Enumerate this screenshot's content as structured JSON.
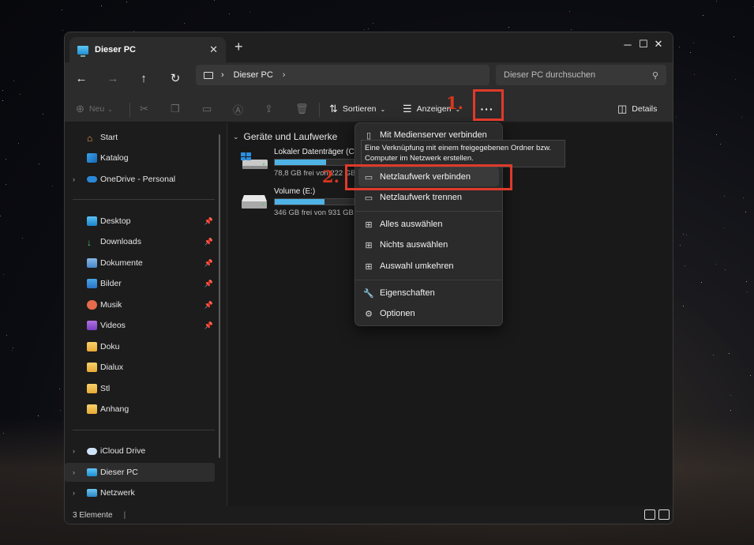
{
  "window": {
    "tab_title": "Dieser PC",
    "tab_close": "✕",
    "new_tab": "+",
    "minimize": "─",
    "maximize": "☐",
    "close": "✕"
  },
  "nav": {
    "back": "←",
    "forward": "→",
    "up": "↑",
    "refresh": "↻"
  },
  "address": {
    "sep1": "›",
    "path": "Dieser PC",
    "sep2": "›"
  },
  "search": {
    "placeholder": "Dieser PC durchsuchen",
    "icon": "⚲"
  },
  "toolbar": {
    "new_label": "Neu",
    "sort_label": "Sortieren",
    "view_label": "Anzeigen",
    "more_label": "···",
    "details_label": "Details"
  },
  "sidebar": {
    "items": [
      {
        "label": "Start",
        "icon": "home-icon"
      },
      {
        "label": "Katalog",
        "icon": "gallery-icon"
      },
      {
        "label": "OneDrive - Personal",
        "icon": "onedrive-icon"
      },
      {
        "label": "Desktop",
        "icon": "desktop-icon"
      },
      {
        "label": "Downloads",
        "icon": "downloads-icon"
      },
      {
        "label": "Dokumente",
        "icon": "documents-icon"
      },
      {
        "label": "Bilder",
        "icon": "pictures-icon"
      },
      {
        "label": "Musik",
        "icon": "music-icon"
      },
      {
        "label": "Videos",
        "icon": "videos-icon"
      },
      {
        "label": "Doku",
        "icon": "folder-icon"
      },
      {
        "label": "Dialux",
        "icon": "folder-icon"
      },
      {
        "label": "Stl",
        "icon": "folder-icon"
      },
      {
        "label": "Anhang",
        "icon": "folder-icon"
      },
      {
        "label": "iCloud Drive",
        "icon": "icloud-icon"
      },
      {
        "label": "Dieser PC",
        "icon": "this-pc-icon"
      },
      {
        "label": "Netzwerk",
        "icon": "network-icon"
      }
    ]
  },
  "content": {
    "group_title": "Geräte und Laufwerke",
    "drives": [
      {
        "name": "Lokaler Datenträger (C:)",
        "free": "78,8 GB frei von 222 GB",
        "used_fraction": 0.645
      },
      {
        "name": "Volume (E:)",
        "free": "346 GB frei von 931 GB",
        "used_fraction": 0.63
      }
    ]
  },
  "menu": {
    "items": [
      {
        "label": "Mit Medienserver verbinden",
        "icon": "media-server-icon"
      },
      {
        "label": "Netzlaufwerk verbinden",
        "icon": "map-network-drive-icon"
      },
      {
        "label": "Netzlaufwerk trennen",
        "icon": "disconnect-network-drive-icon"
      },
      {
        "label": "Alles auswählen",
        "icon": "select-all-icon"
      },
      {
        "label": "Nichts auswählen",
        "icon": "select-none-icon"
      },
      {
        "label": "Auswahl umkehren",
        "icon": "invert-selection-icon"
      },
      {
        "label": "Eigenschaften",
        "icon": "properties-icon"
      },
      {
        "label": "Optionen",
        "icon": "options-icon"
      }
    ],
    "tooltip": "Eine Verknüpfung mit einem freigegebenen Ordner bzw. Computer im Netzwerk erstellen."
  },
  "annotations": {
    "step1": "1.",
    "step2": "2.",
    "color": "#e03a2a"
  },
  "statusbar": {
    "count": "3 Elemente",
    "sep": "|"
  }
}
